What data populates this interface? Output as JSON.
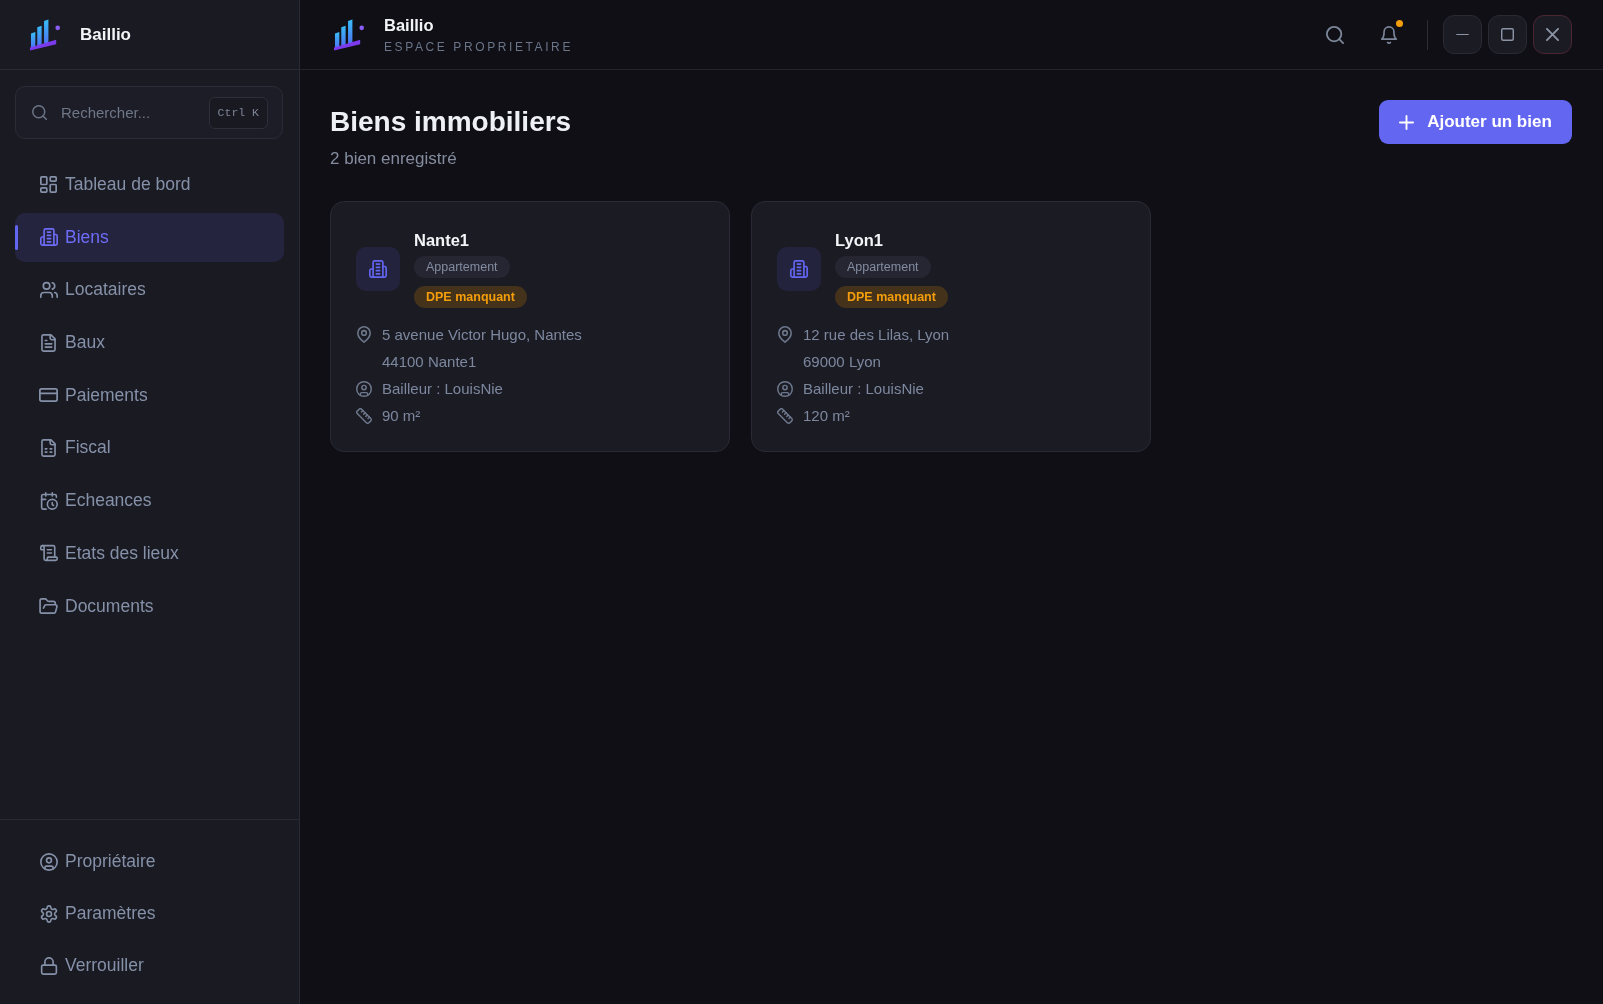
{
  "sidebar": {
    "brand": "Baillio",
    "search": {
      "placeholder": "Rechercher...",
      "shortcut": "Ctrl K"
    },
    "nav_items": [
      {
        "label": "Tableau de bord",
        "kind": "dashboard",
        "selected": false
      },
      {
        "label": "Biens",
        "kind": "properties",
        "selected": true
      },
      {
        "label": "Locataires",
        "kind": "tenants",
        "selected": false
      },
      {
        "label": "Baux",
        "kind": "leases",
        "selected": false
      },
      {
        "label": "Paiements",
        "kind": "payments",
        "selected": false
      },
      {
        "label": "Fiscal",
        "kind": "tax",
        "selected": false
      },
      {
        "label": "Echeances",
        "kind": "deadlines",
        "selected": false
      },
      {
        "label": "Etats des lieux",
        "kind": "inspections",
        "selected": false
      },
      {
        "label": "Documents",
        "kind": "documents",
        "selected": false
      }
    ],
    "footer_items": [
      {
        "label": "Propriétaire",
        "kind": "owner",
        "selected": false
      },
      {
        "label": "Paramètres",
        "kind": "settings",
        "selected": false
      },
      {
        "label": "Verrouiller",
        "kind": "lock",
        "selected": false
      }
    ]
  },
  "topbar": {
    "brand": "Baillio",
    "subtitle": "ESPACE PROPRIETAIRE",
    "notifications": {
      "unread": true
    },
    "window_controls": [
      {
        "kind": "minimize"
      },
      {
        "kind": "maximize"
      },
      {
        "kind": "close"
      }
    ]
  },
  "page": {
    "title": "Biens immobiliers",
    "subtitle": "2 bien enregistré",
    "add_button": {
      "label": "Ajouter un bien"
    }
  },
  "properties": [
    {
      "name": "Nante1",
      "tags": [
        {
          "label": "Appartement",
          "kind": "type"
        },
        {
          "label": "DPE manquant",
          "kind": "warning"
        }
      ],
      "address": [
        "5 avenue Victor Hugo, Nantes",
        "44100 Nante1"
      ],
      "landlord": "Bailleur : LouisNie",
      "surface": "90 m²"
    },
    {
      "name": "Lyon1",
      "tags": [
        {
          "label": "Appartement",
          "kind": "type"
        },
        {
          "label": "DPE manquant",
          "kind": "warning"
        }
      ],
      "address": [
        "12 rue des Lilas, Lyon",
        "69000 Lyon"
      ],
      "landlord": "Bailleur : LouisNie",
      "surface": "120 m²"
    }
  ]
}
